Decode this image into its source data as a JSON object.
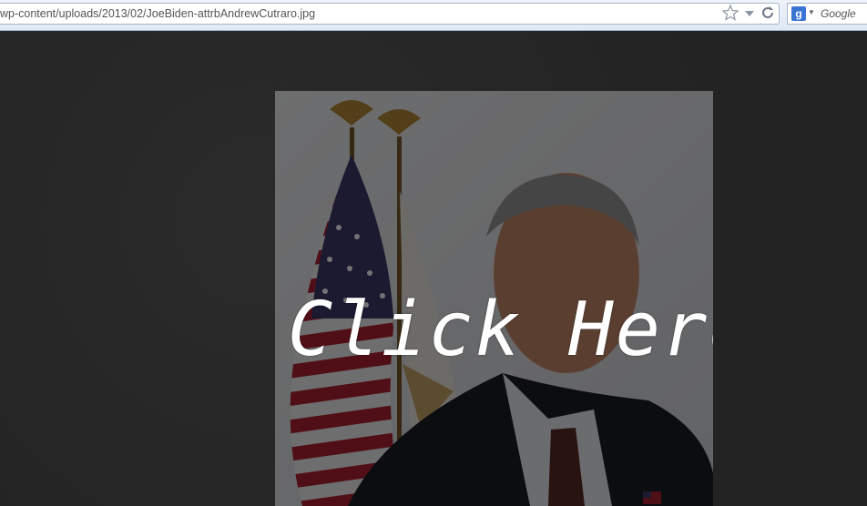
{
  "browser": {
    "url": "wp-content/uploads/2013/02/JoeBiden-attrbAndrewCutraro.jpg",
    "search_engine_label": "Google",
    "search_badge_letter": "g"
  },
  "content": {
    "overlay_text": "Click Here",
    "image_description": "photo"
  },
  "colors": {
    "page_background": "#262626",
    "overlay_text": "#ffffff",
    "flag_red": "#b22234",
    "flag_blue": "#3c3b6e"
  },
  "icons": [
    "star-icon",
    "dropdown-arrow-icon",
    "reload-icon",
    "google-search-icon",
    "caret-down-icon"
  ]
}
